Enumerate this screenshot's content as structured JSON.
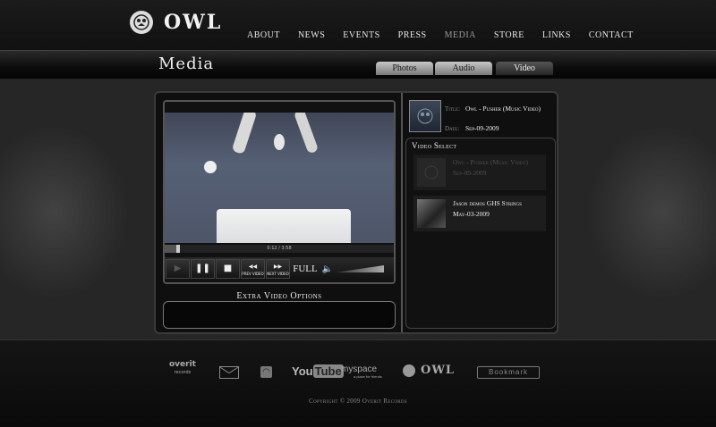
{
  "header": {
    "logo_text": "OWL",
    "nav": [
      "ABOUT",
      "NEWS",
      "EVENTS",
      "PRESS",
      "MEDIA",
      "STORE",
      "LINKS",
      "CONTACT"
    ],
    "active_nav": "MEDIA"
  },
  "page": {
    "title": "Media",
    "tabs": [
      "Photos",
      "Audio",
      "Video"
    ],
    "active_tab": "Video"
  },
  "player": {
    "timecode": "0:12 / 3:58",
    "progress": 0.05,
    "controls": {
      "prev_label": "PREV VIDEO",
      "next_label": "NEXT VIDEO",
      "full_label": "FULL"
    },
    "volume": 0.85,
    "extra_options_label": "Extra Video Options"
  },
  "now_playing": {
    "title_label": "Title:",
    "title_value": "Owl - Pusher (Music Video)",
    "date_label": "Date:",
    "date_value": "Sep-09-2009"
  },
  "video_select": {
    "heading": "Video Select",
    "items": [
      {
        "title": "Owl - Pusher (Music Video)",
        "date": "Sep-09-2009",
        "state": "current"
      },
      {
        "title": "Jason demos GHS Strings",
        "date": "May-03-2009",
        "state": "available"
      }
    ]
  },
  "footer": {
    "overit": "overit",
    "overit_sub": "records",
    "youtube_a": "You",
    "youtube_b": "Tube",
    "myspace": "myspace",
    "myspace_sub": "a place for friends",
    "owl": "OWL",
    "bookmark": "Bookmark",
    "copyright": "Copyright © 2009 Overit Records"
  },
  "colors": {
    "background": "#0a0a0a",
    "tab_active": "#262626",
    "tab_inactive": "#a0a0a0"
  }
}
